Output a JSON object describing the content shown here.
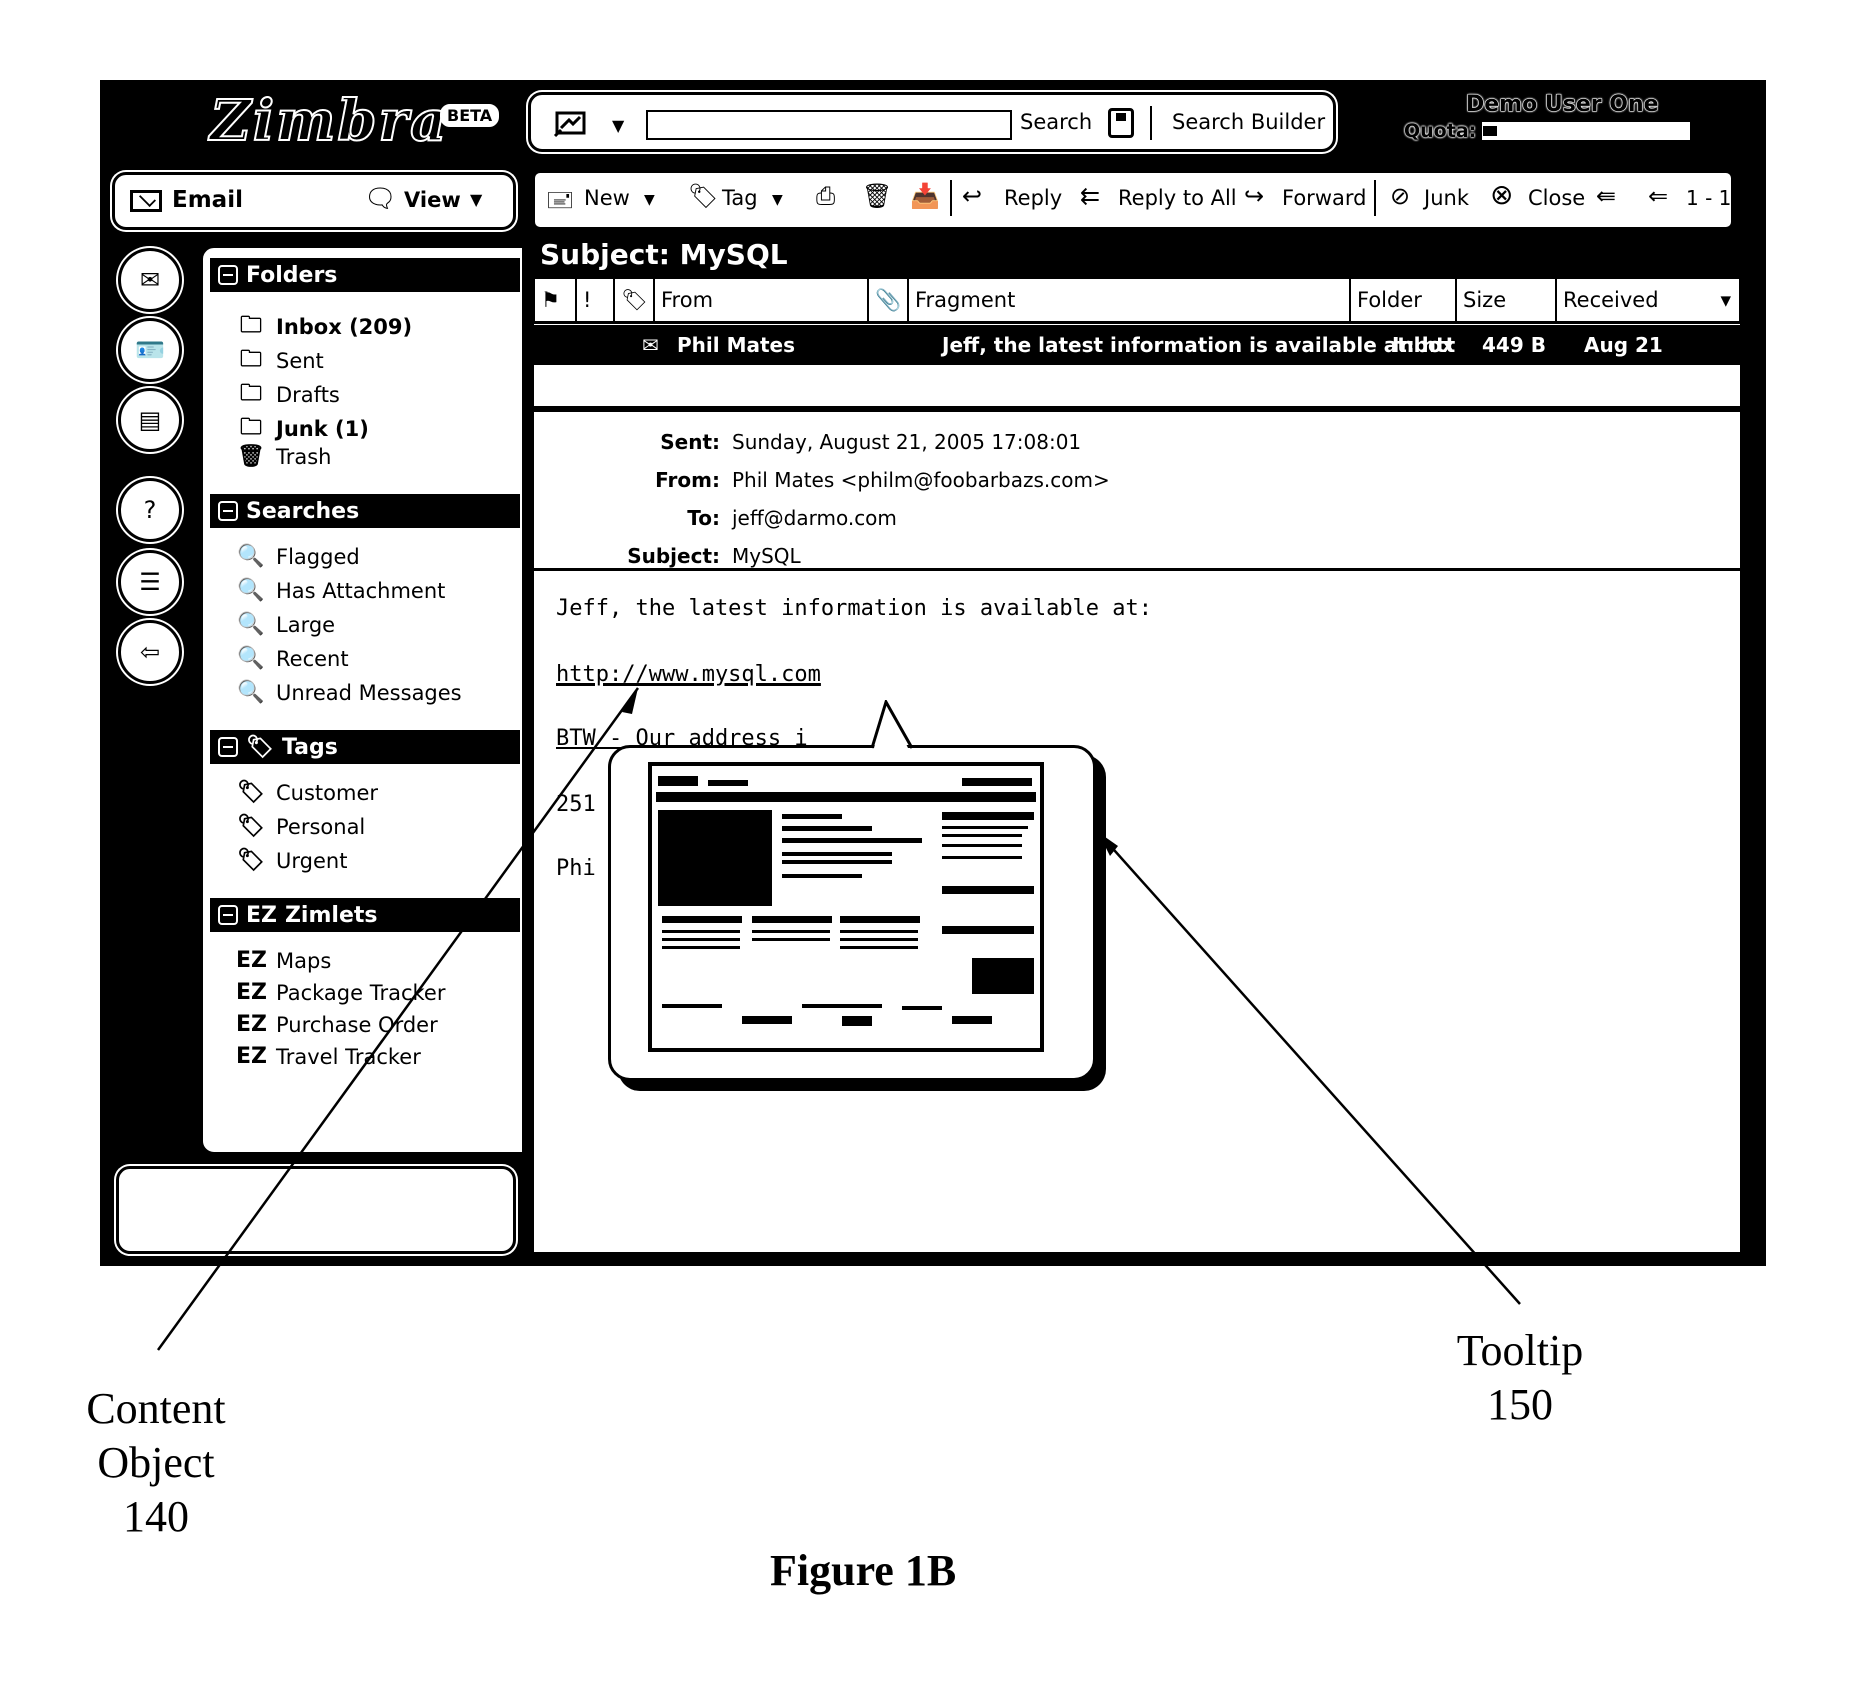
{
  "app": {
    "logo_text": "Zimbra",
    "logo_badge": "BETA"
  },
  "search": {
    "type_icon": "mail-search-icon",
    "input_value": "",
    "input_placeholder": "",
    "search_label": "Search",
    "save_icon": "save-search-icon",
    "builder_label": "Search Builder"
  },
  "user": {
    "name": "Demo User One",
    "quota_label": "Quota:",
    "quota_used_fraction": 0.07
  },
  "appbar": {
    "app_label": "Email",
    "view_label": "View"
  },
  "toolbar": {
    "new_label": "New",
    "tag_label": "Tag",
    "print_icon": "print-icon",
    "delete_icon": "delete-icon",
    "move_icon": "move-icon",
    "reply_label": "Reply",
    "reply_all_label": "Reply to All",
    "forward_label": "Forward",
    "junk_label": "Junk",
    "close_label": "Close",
    "paging_label": "1 - 1"
  },
  "rail": [
    {
      "icon": "mail-icon"
    },
    {
      "icon": "contacts-icon"
    },
    {
      "icon": "calendar-icon"
    },
    {
      "icon": "help-icon"
    },
    {
      "icon": "notes-icon"
    },
    {
      "icon": "logout-icon"
    }
  ],
  "sidebar": {
    "folders": {
      "title": "Folders",
      "items": [
        {
          "label": "Inbox (209)",
          "icon": "inbox-icon",
          "bold": true
        },
        {
          "label": "Sent",
          "icon": "sent-icon",
          "bold": false
        },
        {
          "label": "Drafts",
          "icon": "drafts-icon",
          "bold": false
        },
        {
          "label": "Junk (1)",
          "icon": "junk-icon",
          "bold": true
        },
        {
          "label": "Trash",
          "icon": "trash-icon",
          "bold": false
        }
      ]
    },
    "searches": {
      "title": "Searches",
      "items": [
        {
          "label": "Flagged"
        },
        {
          "label": "Has Attachment"
        },
        {
          "label": "Large"
        },
        {
          "label": "Recent"
        },
        {
          "label": "Unread Messages"
        }
      ]
    },
    "tags": {
      "title": "Tags",
      "items": [
        {
          "label": "Customer"
        },
        {
          "label": "Personal"
        },
        {
          "label": "Urgent"
        }
      ]
    },
    "zimlets": {
      "title": "Zimlets",
      "items": [
        {
          "label": "Maps"
        },
        {
          "label": "Package Tracker"
        },
        {
          "label": "Purchase Order"
        },
        {
          "label": "Travel Tracker"
        }
      ]
    }
  },
  "message_list": {
    "subject_title": "Subject: MySQL",
    "columns": [
      "From",
      "Fragment",
      "Folder",
      "Size",
      "Received"
    ],
    "rows": [
      {
        "from": "Phil Mates",
        "fragment": "Jeff, the latest information is available at: htt",
        "folder": "Inbox",
        "size": "449 B",
        "received": "Aug 21"
      }
    ]
  },
  "message": {
    "headers": [
      {
        "label": "Sent:",
        "value": "Sunday, August 21, 2005 17:08:01"
      },
      {
        "label": "From:",
        "value": "Phil Mates <philm@foobarbazs.com>"
      },
      {
        "label": "To:",
        "value": "jeff@darmo.com"
      },
      {
        "label": "Subject:",
        "value": "MySQL"
      }
    ],
    "body": {
      "line1": "Jeff, the latest information is available at:",
      "link": "http://www.mysql.com",
      "line3": "BTW - Our address i",
      "line4": "251",
      "line5": "Phi"
    }
  },
  "tooltip": {
    "description": "website-preview-thumbnail"
  },
  "annotations": {
    "content_object": [
      "Content",
      "Object",
      "140"
    ],
    "tooltip": [
      "Tooltip",
      "150"
    ],
    "caption": "Figure 1B"
  }
}
